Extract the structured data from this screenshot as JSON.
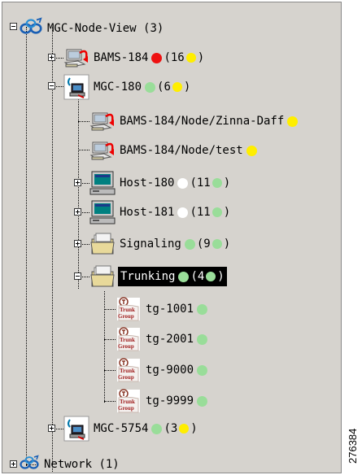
{
  "colors": {
    "red": "#ee1111",
    "yellow": "#ffee00",
    "green": "#99dd99",
    "white": "#ffffff"
  },
  "tree": {
    "root": {
      "label": "MGC-Node-View",
      "count": "(3)",
      "icon": "network-group-icon"
    },
    "bams184": {
      "label": "BAMS-184",
      "count_open": "(16",
      "close": ")",
      "status": "red",
      "inner": "yellow",
      "icon": "bams-server-icon"
    },
    "mgc180": {
      "label": "MGC-180",
      "count_open": "(6",
      "close": ")",
      "status": "green",
      "inner": "yellow",
      "icon": "mgc-node-icon"
    },
    "bams_zinna": {
      "label": "BAMS-184/Node/Zinna-Daff",
      "status": "yellow",
      "icon": "bams-server-icon"
    },
    "bams_test": {
      "label": "BAMS-184/Node/test",
      "status": "yellow",
      "icon": "bams-server-icon"
    },
    "host180": {
      "label": "Host-180",
      "count_open": "(11",
      "close": ")",
      "status": "white",
      "inner": "green",
      "icon": "host-computer-icon"
    },
    "host181": {
      "label": "Host-181",
      "count_open": "(11",
      "close": ")",
      "status": "white",
      "inner": "green",
      "icon": "host-computer-icon"
    },
    "signaling": {
      "label": "Signaling",
      "count_open": "(9",
      "close": ")",
      "status": "green",
      "inner": "green",
      "icon": "folder-icon"
    },
    "trunking": {
      "label": "Trunking",
      "count_open": "(4",
      "close": ")",
      "status": "green",
      "inner": "green",
      "icon": "folder-icon",
      "selected": true
    },
    "trunk_groups": [
      {
        "label": "tg-1001",
        "status": "green"
      },
      {
        "label": "tg-2001",
        "status": "green"
      },
      {
        "label": "tg-9000",
        "status": "green"
      },
      {
        "label": "tg-9999",
        "status": "green"
      }
    ],
    "trunk_icon_text": [
      "Trunk",
      "Group"
    ],
    "mgc5754": {
      "label": "MGC-5754",
      "count_open": "(3",
      "close": ")",
      "status": "green",
      "inner": "yellow",
      "icon": "mgc-node-icon"
    },
    "network": {
      "label": "Network",
      "count": "(1)",
      "icon": "network-group-icon"
    }
  },
  "figure_id": "276384"
}
